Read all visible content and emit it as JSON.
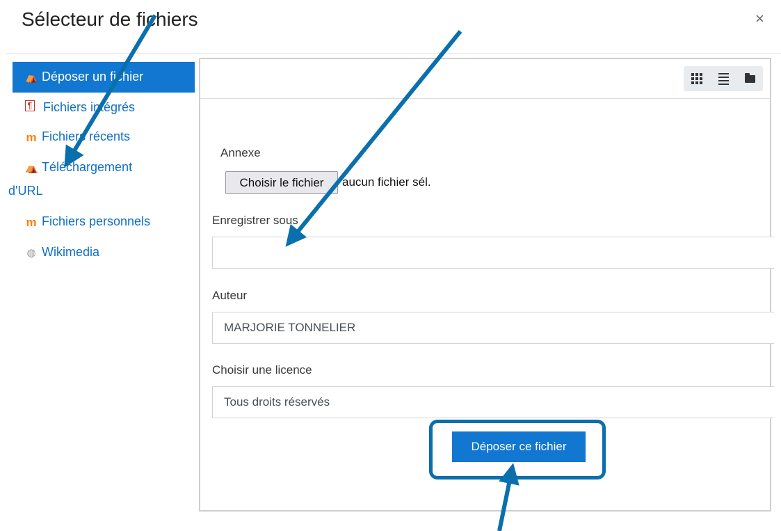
{
  "dialog": {
    "title": "Sélecteur de fichiers",
    "close_symbol": "×"
  },
  "sidebar": {
    "items": [
      {
        "label": "Déposer un fichier",
        "icon": "upload-icon",
        "glyph": "⛺"
      },
      {
        "label": "Fichiers intégrés",
        "icon": "embedded-files-icon",
        "glyph": "📄"
      },
      {
        "label": "Fichiers récents",
        "icon": "moodle-icon",
        "glyph": "m"
      },
      {
        "label": "Téléchargement",
        "label2": "d'URL",
        "icon": "url-download-icon",
        "glyph": "⛺"
      },
      {
        "label": "Fichiers personnels",
        "icon": "moodle-icon",
        "glyph": "m"
      },
      {
        "label": "Wikimedia",
        "icon": "wikipedia-icon",
        "glyph": "◍"
      }
    ]
  },
  "form": {
    "attachment_label": "Annexe",
    "choose_file_button": "Choisir le fichier",
    "file_status": "aucun fichier sél.",
    "save_as_label": "Enregistrer sous",
    "save_as_value": "",
    "author_label": "Auteur",
    "author_value": "MARJORIE TONNELIER",
    "license_label": "Choisir une licence",
    "license_value": "Tous droits réservés",
    "submit_button": "Déposer ce fichier"
  },
  "colors": {
    "accent": "#1177d1",
    "link": "#0f6fc5",
    "annotation": "#0a6fad"
  }
}
